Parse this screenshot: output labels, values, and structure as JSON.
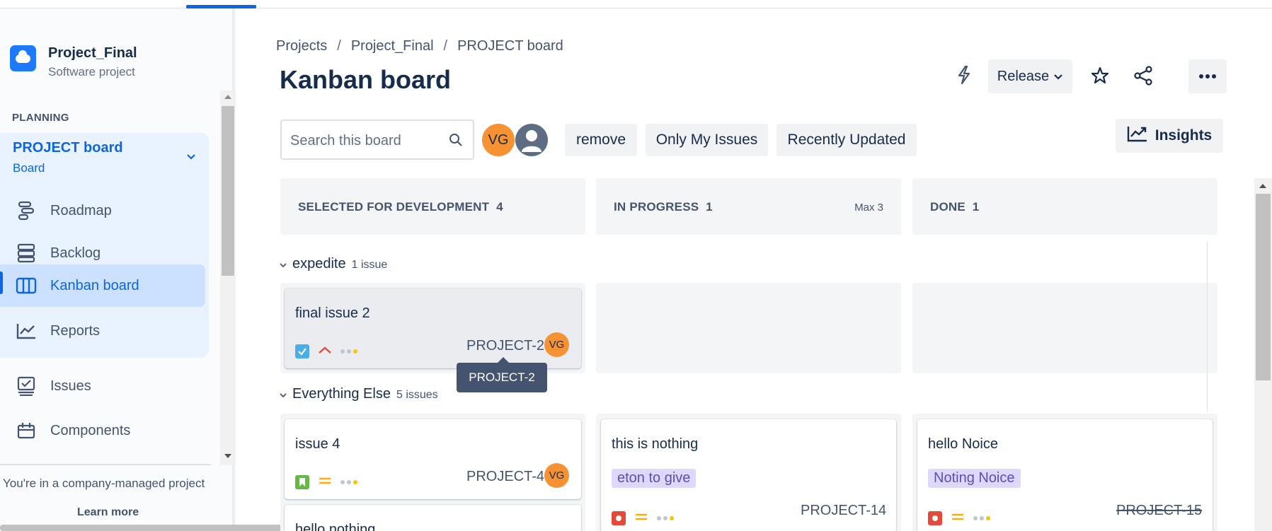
{
  "sidebar": {
    "project_name": "Project_Final",
    "project_type": "Software project",
    "section_label": "PLANNING",
    "board_selector": {
      "title": "PROJECT board",
      "subtitle": "Board"
    },
    "items": [
      {
        "label": "Roadmap",
        "icon": "roadmap-icon"
      },
      {
        "label": "Backlog",
        "icon": "backlog-icon"
      },
      {
        "label": "Kanban board",
        "icon": "board-icon",
        "active": true
      },
      {
        "label": "Reports",
        "icon": "reports-icon"
      },
      {
        "label": "Issues",
        "icon": "issues-icon"
      },
      {
        "label": "Components",
        "icon": "components-icon"
      }
    ],
    "company_note": "You're in a company-managed project",
    "learn_more": "Learn more"
  },
  "breadcrumb": [
    "Projects",
    "Project_Final",
    "PROJECT board"
  ],
  "page_title": "Kanban board",
  "header": {
    "release_label": "Release"
  },
  "toolbar": {
    "search_placeholder": "Search this board",
    "avatar_initials": "VG",
    "filters": [
      "remove",
      "Only My Issues",
      "Recently Updated"
    ],
    "insights_label": "Insights"
  },
  "columns": [
    {
      "name": "SELECTED FOR DEVELOPMENT",
      "count": "4",
      "max": ""
    },
    {
      "name": "IN PROGRESS",
      "count": "1",
      "max": "Max 3"
    },
    {
      "name": "DONE",
      "count": "1",
      "max": ""
    }
  ],
  "swimlanes": [
    {
      "name": "expedite",
      "count": "1 issue"
    },
    {
      "name": "Everything Else",
      "count": "5 issues"
    }
  ],
  "cards": {
    "final_issue_2": {
      "summary": "final issue 2",
      "key": "PROJECT-2",
      "assignee": "VG"
    },
    "issue_4": {
      "summary": "issue 4",
      "key": "PROJECT-4",
      "assignee": "VG"
    },
    "hello_nothing": {
      "summary": "hello nothing"
    },
    "this_is_nothing": {
      "summary": "this is nothing",
      "label": "eton to give",
      "key": "PROJECT-14"
    },
    "hello_noice": {
      "summary": "hello Noice",
      "label": "Noting Noice",
      "key": "PROJECT-15"
    }
  },
  "tooltip": "PROJECT-2",
  "colors": {
    "accent": "#0c66e4",
    "avatar": "#f79232",
    "label_bg": "#dfd8fd",
    "bug": "#e5493a",
    "story": "#65ba43",
    "task": "#4bade8"
  }
}
